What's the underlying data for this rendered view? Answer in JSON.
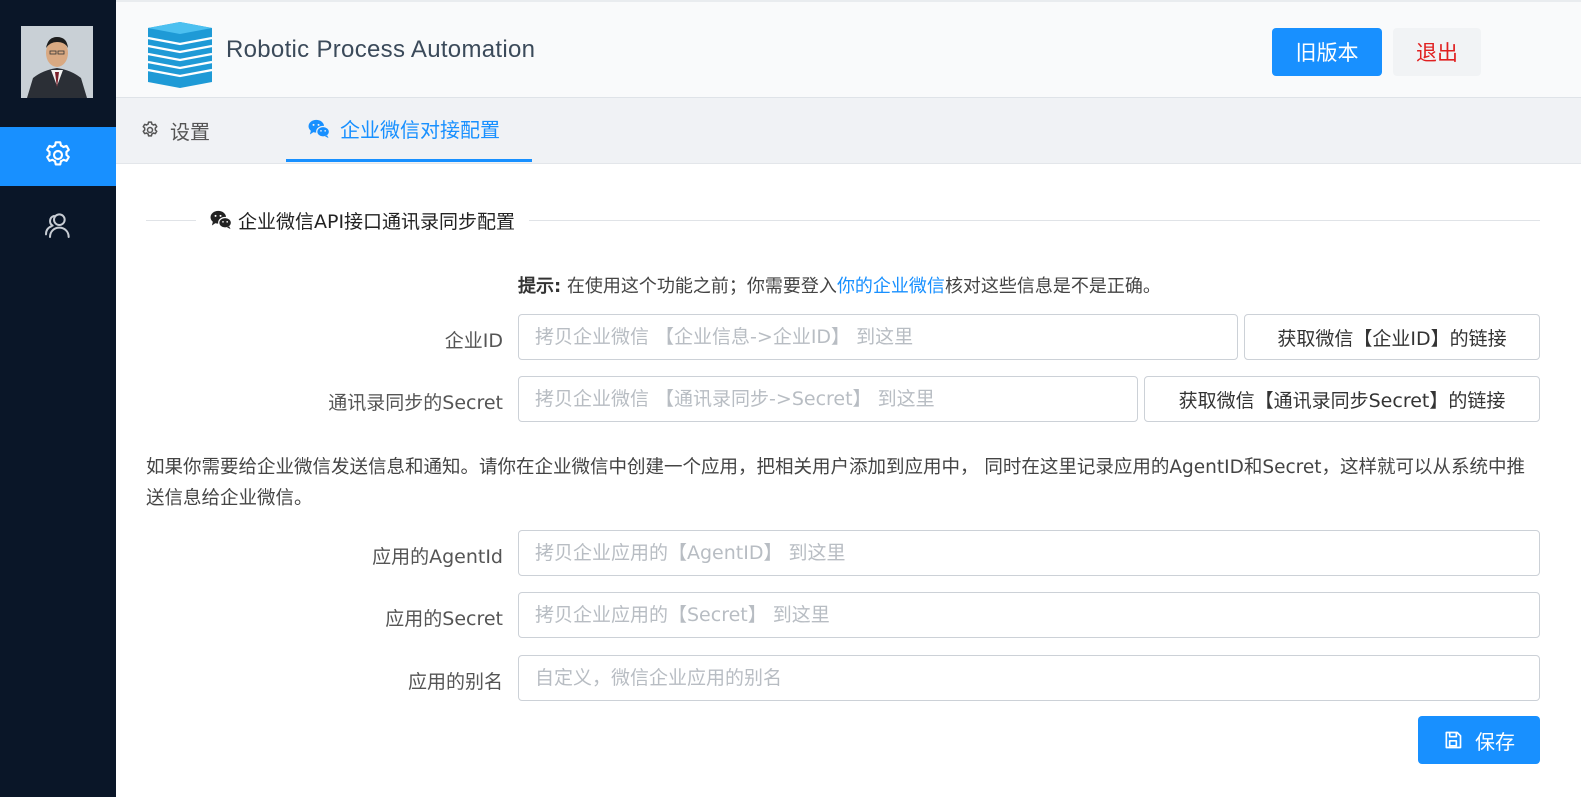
{
  "app": {
    "title": "Robotic Process Automation"
  },
  "header": {
    "old_version_label": "旧版本",
    "logout_label": "退出"
  },
  "sidebar": {
    "items": [
      {
        "icon": "gear-icon"
      },
      {
        "icon": "users-icon"
      }
    ]
  },
  "tabs": [
    {
      "label": "设置",
      "icon": "gear-icon"
    },
    {
      "label": "企业微信对接配置",
      "icon": "wechat-icon"
    }
  ],
  "section": {
    "title": "企业微信API接口通讯录同步配置"
  },
  "hint": {
    "prefix": "提示:",
    "before": " 在使用这个功能之前；你需要登入",
    "link": "你的企业微信",
    "after": "核对这些信息是不是正确。"
  },
  "fields": {
    "corp_id": {
      "label": "企业ID",
      "placeholder": "拷贝企业微信 【企业信息->企业ID】 到这里",
      "button": "获取微信【企业ID】的链接"
    },
    "contact_secret": {
      "label": "通讯录同步的Secret",
      "placeholder": "拷贝企业微信 【通讯录同步->Secret】 到这里",
      "button": "获取微信【通讯录同步Secret】的链接"
    },
    "agent_id": {
      "label": "应用的AgentId",
      "placeholder": "拷贝企业应用的【AgentID】 到这里"
    },
    "app_secret": {
      "label": "应用的Secret",
      "placeholder": "拷贝企业应用的【Secret】 到这里"
    },
    "app_alias": {
      "label": "应用的别名",
      "placeholder": "自定义，微信企业应用的别名"
    }
  },
  "info_text": "如果你需要给企业微信发送信息和通知。请你在企业微信中创建一个应用，把相关用户添加到应用中， 同时在这里记录应用的AgentID和Secret，这样就可以从系统中推送信息给企业微信。",
  "save": {
    "label": "保存"
  },
  "colors": {
    "accent": "#1890ff",
    "sidebar_bg": "#0a1628",
    "logout_text": "#e02020"
  }
}
